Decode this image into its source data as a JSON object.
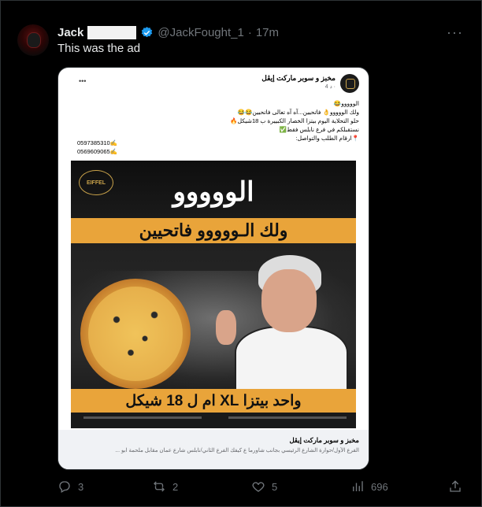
{
  "tweet": {
    "name": "Jack",
    "handle": "@JackFought_1",
    "separator": "·",
    "time": "17m",
    "text": "This was the ad",
    "more": "···"
  },
  "media": {
    "page_name": "مخبز و سوبر ماركت إيڤل",
    "post_meta": "4 د ·",
    "post_lines": [
      "الووووو😂",
      "ولك الووووو👌 فاتحيين...آه آه تعالى فاتحيين😂😂",
      "حلو التحلاية اليوم بيتزا الخصار الكبييرة ب 18شيكل🔥",
      "نستقبلكم في فرع نابلس فقط✅",
      "📍ارقام الطلب والتواصل:"
    ],
    "phones": [
      "0597385310✍",
      "0569609065✍"
    ],
    "ad_logo": "EIFFEL",
    "ad_headline": "الووووو",
    "ad_subheadline": "ولك الـووووو فاتحيين",
    "ad_offer": "واحد بيتزا XL ام ل 18 شيكل",
    "foot_title": "مخبز و سوبر ماركت إيڤل",
    "foot_text": "الفرع الأول/حوارة الشارع الرئيسي بجانب شاورما ع كيفك الفرع الثاني/نابلس شارع عمان مقابل ملحمة ابو ..."
  },
  "actions": {
    "replies": "3",
    "reposts": "2",
    "likes": "5",
    "views": "696"
  },
  "colors": {
    "background": "#000000",
    "muted": "#71767b",
    "verified": "#1d9bf0",
    "ad_band": "#e9a43a"
  }
}
